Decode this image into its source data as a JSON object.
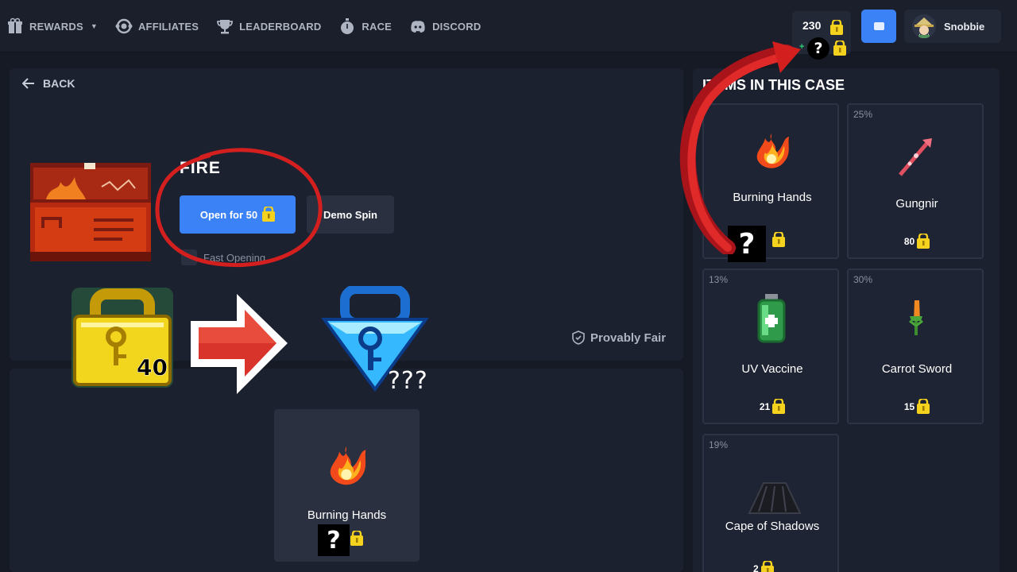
{
  "nav": {
    "items": [
      {
        "label": "REWARDS",
        "icon": "gift-icon",
        "dropdown": true
      },
      {
        "label": "AFFILIATES",
        "icon": "affiliates-icon"
      },
      {
        "label": "LEADERBOARD",
        "icon": "trophy-icon"
      },
      {
        "label": "RACE",
        "icon": "stopwatch-icon"
      },
      {
        "label": "DISCORD",
        "icon": "discord-icon"
      }
    ]
  },
  "balance": {
    "amount": "230",
    "secondary_mark": "?",
    "plus": "+"
  },
  "user": {
    "name": "Snobbie"
  },
  "case": {
    "back_label": "BACK",
    "title": "FIRE",
    "open_label": "Open for 50",
    "demo_label": "Demo Spin",
    "fast_label": "Fast Opening",
    "provably_label": "Provably Fair"
  },
  "overlay": {
    "world_lock_count": "40",
    "unknown_text": "???"
  },
  "result": {
    "name": "Burning Hands",
    "price_mark": "?"
  },
  "items_panel": {
    "title": "ITEMS IN THIS CASE",
    "items": [
      {
        "pct": "",
        "name": "Burning Hands",
        "price": "?",
        "icon": "burning-hands-icon"
      },
      {
        "pct": "25%",
        "name": "Gungnir",
        "price": "80",
        "icon": "gungnir-icon"
      },
      {
        "pct": "13%",
        "name": "UV Vaccine",
        "price": "21",
        "icon": "uv-vaccine-icon"
      },
      {
        "pct": "30%",
        "name": "Carrot Sword",
        "price": "15",
        "icon": "carrot-sword-icon"
      },
      {
        "pct": "19%",
        "name": "Cape of Shadows",
        "price": "2",
        "icon": "cape-icon"
      }
    ]
  },
  "colors": {
    "accent": "#3b82f6",
    "lock": "#f5d21e",
    "annotation": "#d41f1f"
  }
}
